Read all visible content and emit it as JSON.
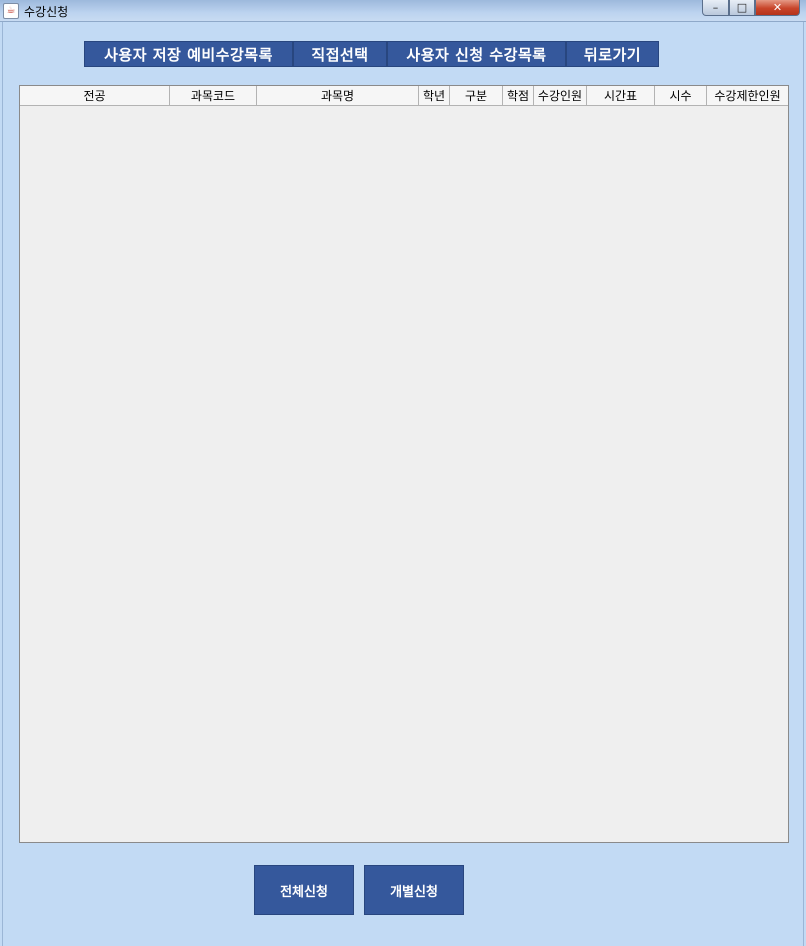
{
  "window": {
    "title": "수강신청",
    "icon": "java-cup-icon",
    "controls": {
      "minimize": "–",
      "maximize": "□",
      "close": "✕"
    }
  },
  "tabs": [
    {
      "label": "사용자 저장 예비수강목록"
    },
    {
      "label": "직접선택"
    },
    {
      "label": "사용자 신청 수강목록"
    },
    {
      "label": "뒤로가기"
    }
  ],
  "table": {
    "columns": [
      "전공",
      "과목코드",
      "과목명",
      "학년",
      "구분",
      "학점",
      "수강인원",
      "시간표",
      "시수",
      "수강제한인원"
    ],
    "rows": []
  },
  "buttons": {
    "apply_all": "전체신청",
    "apply_each": "개별신청"
  },
  "colors": {
    "background": "#c2daf4",
    "button": "#35589c",
    "table_bg": "#efefef"
  }
}
